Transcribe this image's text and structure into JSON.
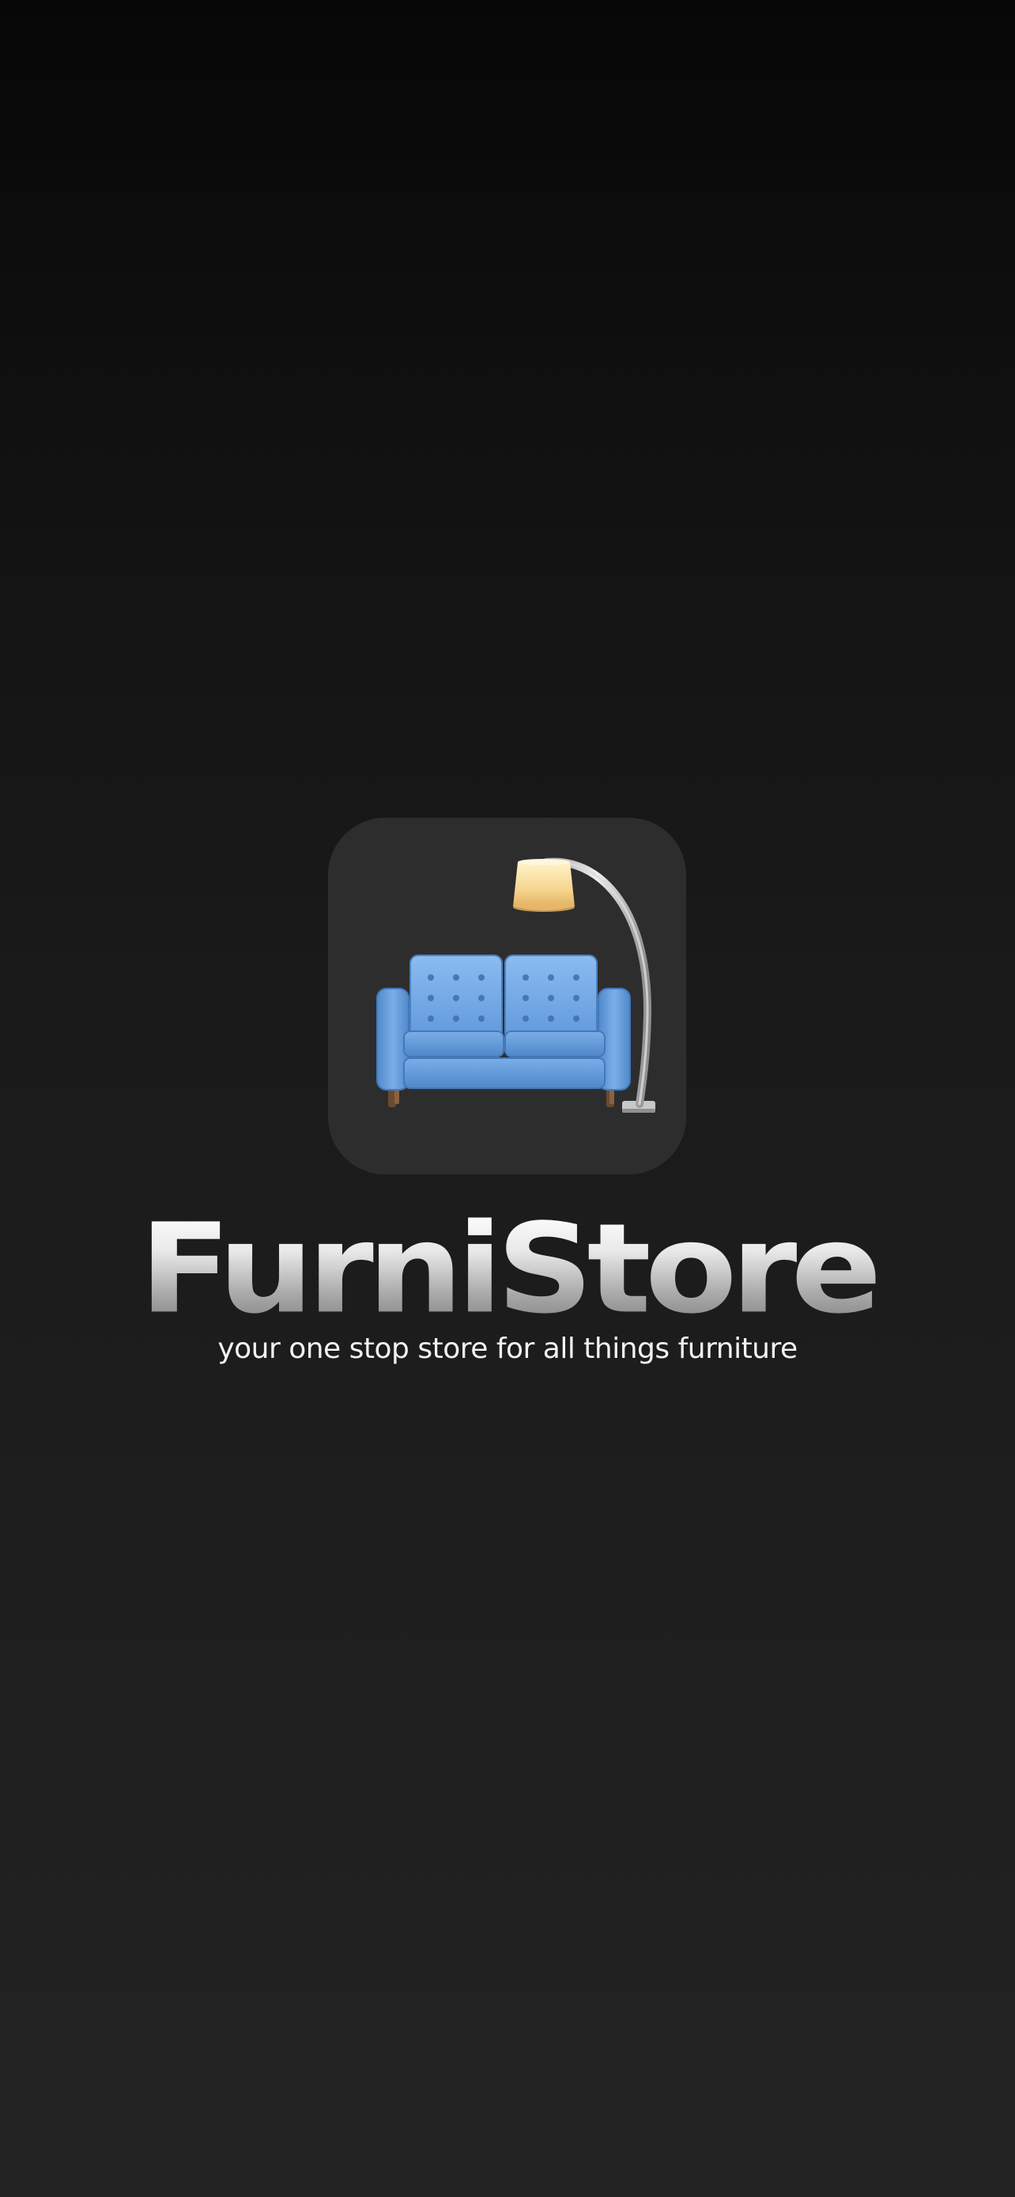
{
  "splash": {
    "app_icon": {
      "icon": "couch-and-lamp-icon",
      "background_color": "#2e2d2e",
      "couch_color": "#5e97d8",
      "lamp_shade_color": "#f6d38b"
    },
    "title": "FurniStore",
    "tagline": "your one stop store for all things furniture"
  },
  "colors": {
    "background_top": "#070707",
    "background_bottom": "#232323",
    "title_gradient_top": "#ffffff",
    "title_gradient_bottom": "#7d7d7d",
    "tagline": "#f2f2f2"
  }
}
